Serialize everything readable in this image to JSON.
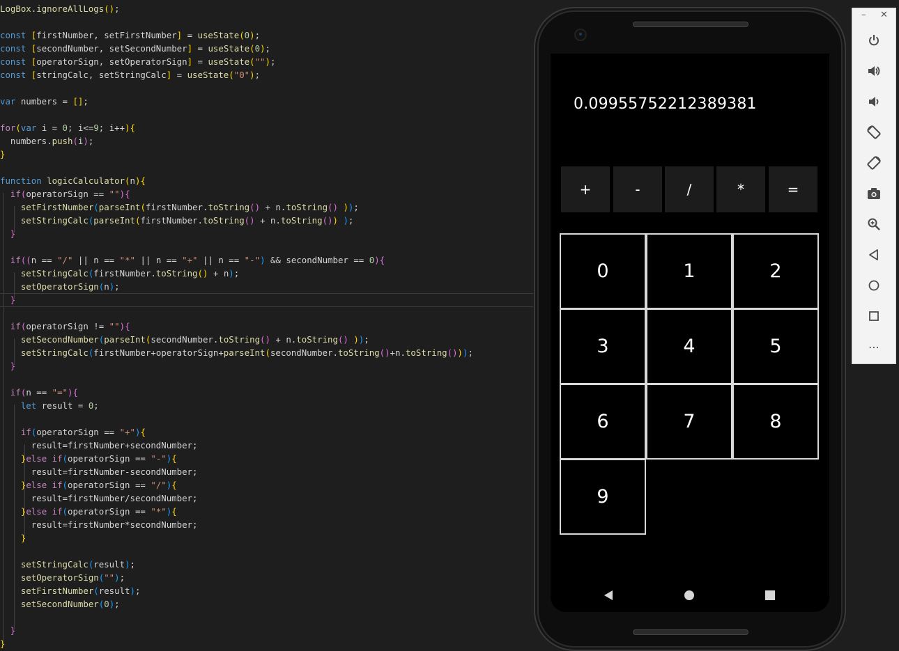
{
  "colors": {
    "editor_bg": "#1e1e1e",
    "keyword": "#569cd6",
    "control": "#c586c0",
    "function": "#dcdcaa",
    "string": "#ce9178",
    "number": "#b5cea8",
    "default": "#d4d4d4",
    "bracket_yellow": "#ffd700",
    "bracket_purple": "#da70d6",
    "bracket_blue": "#179fff"
  },
  "code": {
    "lines": [
      [
        [
          "f",
          "LogBox"
        ],
        [
          "d",
          "."
        ],
        [
          "f",
          "ignoreAllLogs"
        ],
        [
          "y",
          "()"
        ],
        [
          "d",
          ";"
        ]
      ],
      [],
      [
        [
          "k",
          "const "
        ],
        [
          "y",
          "["
        ],
        [
          "d",
          "firstNumber, setFirstNumber"
        ],
        [
          "y",
          "]"
        ],
        [
          "d",
          " = "
        ],
        [
          "f",
          "useState"
        ],
        [
          "y",
          "("
        ],
        [
          "n",
          "0"
        ],
        [
          "y",
          ")"
        ],
        [
          "d",
          ";"
        ]
      ],
      [
        [
          "k",
          "const "
        ],
        [
          "y",
          "["
        ],
        [
          "d",
          "secondNumber, setSecondNumber"
        ],
        [
          "y",
          "]"
        ],
        [
          "d",
          " = "
        ],
        [
          "f",
          "useState"
        ],
        [
          "y",
          "("
        ],
        [
          "n",
          "0"
        ],
        [
          "y",
          ")"
        ],
        [
          "d",
          ";"
        ]
      ],
      [
        [
          "k",
          "const "
        ],
        [
          "y",
          "["
        ],
        [
          "d",
          "operatorSign, setOperatorSign"
        ],
        [
          "y",
          "]"
        ],
        [
          "d",
          " = "
        ],
        [
          "f",
          "useState"
        ],
        [
          "y",
          "("
        ],
        [
          "s",
          "\"\""
        ],
        [
          "y",
          ")"
        ],
        [
          "d",
          ";"
        ]
      ],
      [
        [
          "k",
          "const "
        ],
        [
          "y",
          "["
        ],
        [
          "d",
          "stringCalc, setStringCalc"
        ],
        [
          "y",
          "]"
        ],
        [
          "d",
          " = "
        ],
        [
          "f",
          "useState"
        ],
        [
          "y",
          "("
        ],
        [
          "s",
          "\"0\""
        ],
        [
          "y",
          ")"
        ],
        [
          "d",
          ";"
        ]
      ],
      [],
      [
        [
          "k",
          "var "
        ],
        [
          "d",
          "numbers = "
        ],
        [
          "y",
          "[]"
        ],
        [
          "d",
          ";"
        ]
      ],
      [],
      [
        [
          "c",
          "for"
        ],
        [
          "y",
          "("
        ],
        [
          "k",
          "var "
        ],
        [
          "d",
          "i = "
        ],
        [
          "n",
          "0"
        ],
        [
          "d",
          "; i<="
        ],
        [
          "n",
          "9"
        ],
        [
          "d",
          "; i++"
        ],
        [
          "y",
          ")"
        ],
        [
          "y",
          "{"
        ]
      ],
      [
        [
          "d",
          "  numbers."
        ],
        [
          "f",
          "push"
        ],
        [
          "p",
          "("
        ],
        [
          "d",
          "i"
        ],
        [
          "p",
          ")"
        ],
        [
          "d",
          ";"
        ]
      ],
      [
        [
          "y",
          "}"
        ]
      ],
      [],
      [
        [
          "k",
          "function "
        ],
        [
          "f",
          "logicCalculator"
        ],
        [
          "y",
          "("
        ],
        [
          "d",
          "n"
        ],
        [
          "y",
          ")"
        ],
        [
          "y",
          "{"
        ]
      ],
      [
        [
          "d",
          "  "
        ],
        [
          "c",
          "if"
        ],
        [
          "p",
          "("
        ],
        [
          "d",
          "operatorSign == "
        ],
        [
          "s",
          "\"\""
        ],
        [
          "p",
          ")"
        ],
        [
          "p",
          "{"
        ]
      ],
      [
        [
          "d",
          "    "
        ],
        [
          "f",
          "setFirstNumber"
        ],
        [
          "b",
          "("
        ],
        [
          "f",
          "parseInt"
        ],
        [
          "y",
          "("
        ],
        [
          "d",
          "firstNumber."
        ],
        [
          "f",
          "toString"
        ],
        [
          "p",
          "()"
        ],
        [
          "d",
          " + n."
        ],
        [
          "f",
          "toString"
        ],
        [
          "p",
          "()"
        ],
        [
          "d",
          " "
        ],
        [
          "y",
          ")"
        ],
        [
          "b",
          ")"
        ],
        [
          "d",
          ";"
        ]
      ],
      [
        [
          "d",
          "    "
        ],
        [
          "f",
          "setStringCalc"
        ],
        [
          "b",
          "("
        ],
        [
          "f",
          "parseInt"
        ],
        [
          "y",
          "("
        ],
        [
          "d",
          "firstNumber."
        ],
        [
          "f",
          "toString"
        ],
        [
          "p",
          "()"
        ],
        [
          "d",
          " + n."
        ],
        [
          "f",
          "toString"
        ],
        [
          "p",
          "()"
        ],
        [
          "y",
          ")"
        ],
        [
          "d",
          " "
        ],
        [
          "b",
          ")"
        ],
        [
          "d",
          ";"
        ]
      ],
      [
        [
          "d",
          "  "
        ],
        [
          "p",
          "}"
        ]
      ],
      [],
      [
        [
          "d",
          "  "
        ],
        [
          "c",
          "if"
        ],
        [
          "p",
          "(("
        ],
        [
          "d",
          "n == "
        ],
        [
          "s",
          "\"/\""
        ],
        [
          "d",
          " || n == "
        ],
        [
          "s",
          "\"*\""
        ],
        [
          "d",
          " || n == "
        ],
        [
          "s",
          "\"+\""
        ],
        [
          "d",
          " || n == "
        ],
        [
          "s",
          "\"-\""
        ],
        [
          "b",
          ")"
        ],
        [
          "d",
          " && secondNumber == "
        ],
        [
          "n",
          "0"
        ],
        [
          "p",
          ")"
        ],
        [
          "p",
          "{"
        ]
      ],
      [
        [
          "d",
          "    "
        ],
        [
          "f",
          "setStringCalc"
        ],
        [
          "b",
          "("
        ],
        [
          "d",
          "firstNumber."
        ],
        [
          "f",
          "toString"
        ],
        [
          "y",
          "()"
        ],
        [
          "d",
          " + n"
        ],
        [
          "b",
          ")"
        ],
        [
          "d",
          ";"
        ]
      ],
      [
        [
          "d",
          "    "
        ],
        [
          "f",
          "setOperatorSign"
        ],
        [
          "b",
          "("
        ],
        [
          "d",
          "n"
        ],
        [
          "b",
          ")"
        ],
        [
          "d",
          ";"
        ]
      ],
      [
        [
          "d",
          "  "
        ],
        [
          "p",
          "}"
        ]
      ],
      [],
      [
        [
          "d",
          "  "
        ],
        [
          "c",
          "if"
        ],
        [
          "p",
          "("
        ],
        [
          "d",
          "operatorSign != "
        ],
        [
          "s",
          "\"\""
        ],
        [
          "p",
          ")"
        ],
        [
          "p",
          "{"
        ]
      ],
      [
        [
          "d",
          "    "
        ],
        [
          "f",
          "setSecondNumber"
        ],
        [
          "b",
          "("
        ],
        [
          "f",
          "parseInt"
        ],
        [
          "y",
          "("
        ],
        [
          "d",
          "secondNumber."
        ],
        [
          "f",
          "toString"
        ],
        [
          "p",
          "()"
        ],
        [
          "d",
          " + n."
        ],
        [
          "f",
          "toString"
        ],
        [
          "p",
          "()"
        ],
        [
          "d",
          " "
        ],
        [
          "y",
          ")"
        ],
        [
          "b",
          ")"
        ],
        [
          "d",
          ";"
        ]
      ],
      [
        [
          "d",
          "    "
        ],
        [
          "f",
          "setStringCalc"
        ],
        [
          "b",
          "("
        ],
        [
          "d",
          "firstNumber+operatorSign+"
        ],
        [
          "f",
          "parseInt"
        ],
        [
          "y",
          "("
        ],
        [
          "d",
          "secondNumber."
        ],
        [
          "f",
          "toString"
        ],
        [
          "p",
          "()"
        ],
        [
          "d",
          "+n."
        ],
        [
          "f",
          "toString"
        ],
        [
          "p",
          "()"
        ],
        [
          "y",
          ")"
        ],
        [
          "b",
          ")"
        ],
        [
          "d",
          ";"
        ]
      ],
      [
        [
          "d",
          "  "
        ],
        [
          "p",
          "}"
        ]
      ],
      [],
      [
        [
          "d",
          "  "
        ],
        [
          "c",
          "if"
        ],
        [
          "p",
          "("
        ],
        [
          "d",
          "n == "
        ],
        [
          "s",
          "\"=\""
        ],
        [
          "p",
          ")"
        ],
        [
          "p",
          "{"
        ]
      ],
      [
        [
          "d",
          "    "
        ],
        [
          "k",
          "let "
        ],
        [
          "d",
          "result = "
        ],
        [
          "n",
          "0"
        ],
        [
          "d",
          ";"
        ]
      ],
      [],
      [
        [
          "d",
          "    "
        ],
        [
          "c",
          "if"
        ],
        [
          "b",
          "("
        ],
        [
          "d",
          "operatorSign == "
        ],
        [
          "s",
          "\"+\""
        ],
        [
          "b",
          ")"
        ],
        [
          "y",
          "{"
        ]
      ],
      [
        [
          "d",
          "      result=firstNumber+secondNumber;"
        ]
      ],
      [
        [
          "d",
          "    "
        ],
        [
          "y",
          "}"
        ],
        [
          "c",
          "else if"
        ],
        [
          "b",
          "("
        ],
        [
          "d",
          "operatorSign == "
        ],
        [
          "s",
          "\"-\""
        ],
        [
          "b",
          ")"
        ],
        [
          "y",
          "{"
        ]
      ],
      [
        [
          "d",
          "      result=firstNumber-secondNumber;"
        ]
      ],
      [
        [
          "d",
          "    "
        ],
        [
          "y",
          "}"
        ],
        [
          "c",
          "else if"
        ],
        [
          "b",
          "("
        ],
        [
          "d",
          "operatorSign == "
        ],
        [
          "s",
          "\"/\""
        ],
        [
          "b",
          ")"
        ],
        [
          "y",
          "{"
        ]
      ],
      [
        [
          "d",
          "      result=firstNumber/secondNumber;"
        ]
      ],
      [
        [
          "d",
          "    "
        ],
        [
          "y",
          "}"
        ],
        [
          "c",
          "else if"
        ],
        [
          "b",
          "("
        ],
        [
          "d",
          "operatorSign == "
        ],
        [
          "s",
          "\"*\""
        ],
        [
          "b",
          ")"
        ],
        [
          "y",
          "{"
        ]
      ],
      [
        [
          "d",
          "      result=firstNumber*secondNumber;"
        ]
      ],
      [
        [
          "d",
          "    "
        ],
        [
          "y",
          "}"
        ]
      ],
      [],
      [
        [
          "d",
          "    "
        ],
        [
          "f",
          "setStringCalc"
        ],
        [
          "b",
          "("
        ],
        [
          "d",
          "result"
        ],
        [
          "b",
          ")"
        ],
        [
          "d",
          ";"
        ]
      ],
      [
        [
          "d",
          "    "
        ],
        [
          "f",
          "setOperatorSign"
        ],
        [
          "b",
          "("
        ],
        [
          "s",
          "\"\""
        ],
        [
          "b",
          ")"
        ],
        [
          "d",
          ";"
        ]
      ],
      [
        [
          "d",
          "    "
        ],
        [
          "f",
          "setFirstNumber"
        ],
        [
          "b",
          "("
        ],
        [
          "d",
          "result"
        ],
        [
          "b",
          ")"
        ],
        [
          "d",
          ";"
        ]
      ],
      [
        [
          "d",
          "    "
        ],
        [
          "f",
          "setSecondNumber"
        ],
        [
          "b",
          "("
        ],
        [
          "n",
          "0"
        ],
        [
          "b",
          ")"
        ],
        [
          "d",
          ";"
        ]
      ],
      [],
      [
        [
          "d",
          "  "
        ],
        [
          "p",
          "}"
        ]
      ],
      [
        [
          "y",
          "}"
        ]
      ]
    ]
  },
  "phone": {
    "display_value": "0.09955752212389381",
    "operators": [
      "+",
      "-",
      "/",
      "*",
      "="
    ],
    "digits": [
      "0",
      "1",
      "2",
      "3",
      "4",
      "5",
      "6",
      "7",
      "8",
      "9"
    ]
  },
  "toolbar": {
    "minimize": "–",
    "close": "✕",
    "more": "⋯",
    "icons": [
      "power-icon",
      "volume-up-icon",
      "volume-down-icon",
      "rotate-left-icon",
      "rotate-right-icon",
      "camera-icon",
      "zoom-icon",
      "back-icon",
      "home-icon",
      "overview-icon",
      "more-icon"
    ]
  }
}
